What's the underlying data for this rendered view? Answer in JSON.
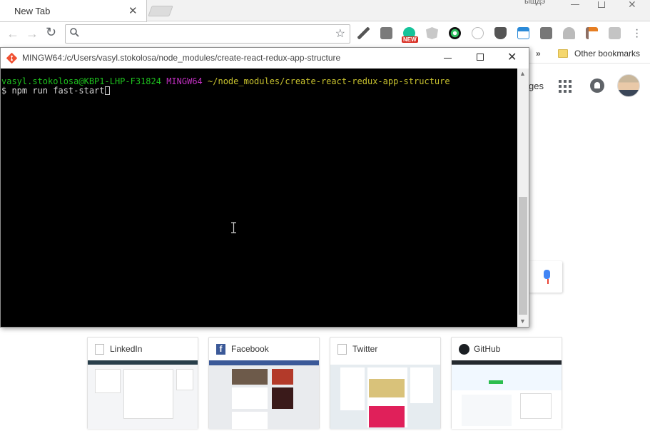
{
  "browser": {
    "tab": {
      "title": "New Tab",
      "close_glyph": "✕"
    },
    "top_right_text": "ыщдэ",
    "toolbar": {
      "back_glyph": "←",
      "forward_glyph": "→",
      "reload_glyph": "↻",
      "star_glyph": "☆",
      "omnibox_value": "",
      "new_badge": "NEW",
      "extension_icons": [
        "eyedropper-icon",
        "extension-icon",
        "grammarly-icon",
        "angular-icon",
        "colorpick-icon",
        "react-icon",
        "pocket-icon",
        "window-icon",
        "cb-icon",
        "umbrella-icon",
        "tool-icon",
        "settings-icon"
      ]
    },
    "bookmarks": {
      "overflow": "»",
      "other": "Other bookmarks"
    },
    "ntp": {
      "images_text": "ges",
      "tiles": [
        {
          "title": "LinkedIn",
          "icon": "page-icon"
        },
        {
          "title": "Facebook",
          "icon": "facebook-icon",
          "icon_glyph": "f"
        },
        {
          "title": "Twitter",
          "icon": "page-icon"
        },
        {
          "title": "GitHub",
          "icon": "github-icon"
        }
      ]
    }
  },
  "terminal": {
    "title": "MINGW64:/c/Users/vasyl.stokolosa/node_modules/create-react-redux-app-structure",
    "close_glyph": "✕",
    "prompt_user": "vasyl.stokolosa@KBP1-LHP-F31824",
    "prompt_env": "MINGW64",
    "prompt_path": "~/node_modules/create-react-redux-app-structure",
    "command": "$ npm run fast-start"
  }
}
